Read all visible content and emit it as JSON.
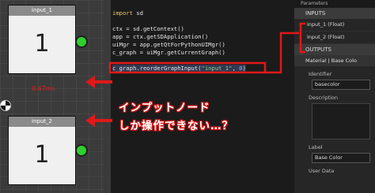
{
  "graph": {
    "node1": {
      "title": "input_1",
      "value": "1"
    },
    "node2": {
      "title": "input_2",
      "value": "1"
    },
    "timing": "0.67ms"
  },
  "editor": {
    "lines": [
      [
        {
          "t": "import",
          "c": "kw"
        },
        {
          "t": " sd"
        }
      ],
      [
        {
          "t": ""
        }
      ],
      [
        {
          "t": "ctx = sd.getContext()"
        }
      ],
      [
        {
          "t": "app = ctx.getSDApplication()"
        }
      ],
      [
        {
          "t": "uiMgr = app.getQtForPythonUIMgr()"
        }
      ],
      [
        {
          "t": "c_graph = uiMgr.getCurrentGraph()"
        }
      ],
      [
        {
          "t": ""
        }
      ],
      [
        {
          "t": "c_graph.reorderGraphInput("
        },
        {
          "t": "\"input_1\"",
          "c": "str"
        },
        {
          "t": ", "
        },
        {
          "t": "0",
          "c": "num"
        },
        {
          "t": ")"
        }
      ]
    ]
  },
  "panel": {
    "tab": "Parameters",
    "inputs_header": "INPUTS",
    "input_rows": [
      "input_1 (Float)",
      "input_2 (Float)"
    ],
    "outputs_header": "OUTPUTS",
    "material_row": "Material | Base Colo",
    "identifier_label": "Identifier",
    "identifier_value": "basecolor",
    "description_label": "Description",
    "label_label": "Label",
    "label_value": "Base Color",
    "user_data_label": "User Data"
  },
  "annotation": {
    "line1": "インプットノード",
    "line2": "しか操作できない…？",
    "color": "#e01818"
  }
}
